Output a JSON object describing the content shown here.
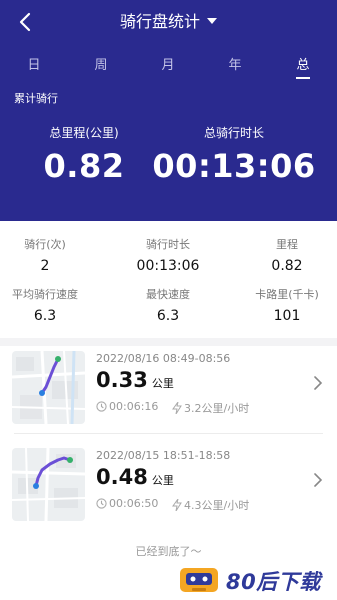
{
  "header": {
    "title": "骑行盘统计",
    "tabs": [
      {
        "label": "日",
        "active": false
      },
      {
        "label": "周",
        "active": false
      },
      {
        "label": "月",
        "active": false
      },
      {
        "label": "年",
        "active": false
      },
      {
        "label": "总",
        "active": true
      }
    ],
    "section_label": "累计骑行",
    "total_distance": {
      "label": "总里程(公里)",
      "value": "0.82"
    },
    "total_duration": {
      "label": "总骑行时长",
      "value": "00:13:06"
    }
  },
  "stats": {
    "rides": {
      "label": "骑行(次)",
      "value": "2"
    },
    "ride_time": {
      "label": "骑行时长",
      "value": "00:13:06"
    },
    "mileage": {
      "label": "里程",
      "value": "0.82"
    },
    "avg_speed": {
      "label": "平均骑行速度",
      "value": "6.3"
    },
    "max_speed": {
      "label": "最快速度",
      "value": "6.3"
    },
    "calories": {
      "label": "卡路里(千卡)",
      "value": "101"
    }
  },
  "records": [
    {
      "date": "2022/08/16 08:49-08:56",
      "distance": "0.33",
      "unit": "公里",
      "duration": "00:06:16",
      "speed": "3.2公里/小时"
    },
    {
      "date": "2022/08/15 18:51-18:58",
      "distance": "0.48",
      "unit": "公里",
      "duration": "00:06:50",
      "speed": "4.3公里/小时"
    }
  ],
  "footer_note": "已经到底了～",
  "watermark": {
    "text": "80后下载"
  },
  "colors": {
    "header_bg": "#2a2a8f",
    "route": "#6b4fd6"
  },
  "icons": [
    "back-icon",
    "caret-down-icon",
    "clock-icon",
    "bolt-icon",
    "chevron-right-icon"
  ]
}
